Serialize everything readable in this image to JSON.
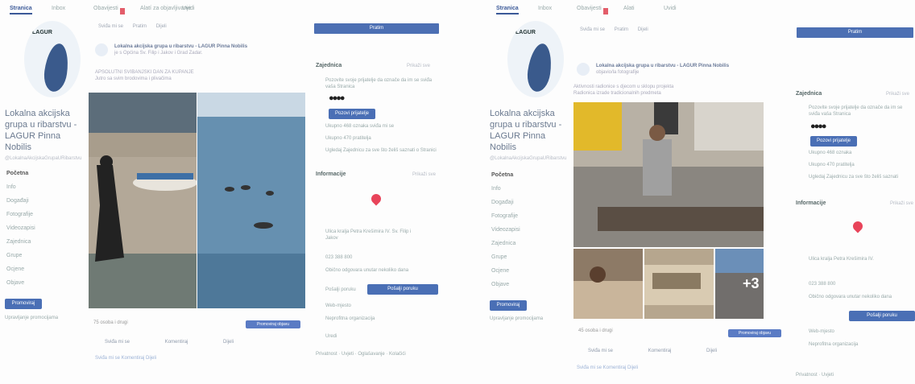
{
  "left": {
    "tabs": [
      "Stranica",
      "Inbox",
      "Obavijesti",
      "Alatí za objavljivanje",
      "Uvidi"
    ],
    "logo_letters": "LAGUR",
    "page_name": "Lokalna akcijska grupa u ribarstvu - LAGUR Pinna Nobilis",
    "handle": "@LokalnaAkcijskaGrupaURibarstvu",
    "nav": [
      "Početna",
      "Info",
      "Događaji",
      "Fotografije",
      "Videozapisi",
      "Zajednica",
      "Grupe",
      "Ocjene",
      "Objave"
    ],
    "promote": "Promoviraj",
    "manage_promotions": "Upravljanje promocijama",
    "action_bar": [
      "Sviđa mi se",
      "Pratim",
      "Dijeli"
    ],
    "post_title": "Lokalna akcijska grupa u ribarstvu - LAGUR Pinna Nobilis",
    "post_sub": "je s Općina Sv. Filip i Jakov i Grad Zadar.",
    "post_text": "APSOLUTNI SVIBANJSKI DAN ZA KUPANJE",
    "post_more": "Jutro sa svim brodovima i plivačima",
    "likes": "75 osoba i drugi",
    "boost": "Promoviraj objavu",
    "reactions": [
      "Sviđa mi se",
      "Komentiraj",
      "Dijeli"
    ],
    "comment": "Sviđa mi se Komentiraj Dijeli",
    "top_button": "Pratim",
    "community_title": "Zajednica",
    "community_link": "Prikaži sve",
    "invite_text": "Pozovite svoje prijatelje da označe da im se sviđa vaša Stranica",
    "invite_btn": "Pozovi prijatelje",
    "c1": "Ukupno 468 oznaka sviđa mi se",
    "c2": "Ukupno 470 pratitelja",
    "c3": "Ugledaj Zajednicu za sve što želiš saznati o Stranici",
    "about_title": "Informacije",
    "about_link": "Prikaži sve",
    "addr": "Ulica kralja Petra Krešimira IV. Sv. Filip i Jakov",
    "phone": "023 388 800",
    "resp": "Obično odgovara unutar nekoliko dana",
    "send_btn": "Pošalji poruku",
    "send_link": "Pošalji poruku",
    "www": "Web-mjesto",
    "category": "Neprofitna organizacija",
    "edit": "Uredi",
    "footer": "Privatnost · Uvjeti · Oglašavanje · Kolačići"
  },
  "right": {
    "tabs": [
      "Stranica",
      "Inbox",
      "Obavijesti",
      "Alati",
      "Uvidi"
    ],
    "logo_letters": "LAGUR",
    "page_name": "Lokalna akcijska grupa u ribarstvu - LAGUR Pinna Nobilis",
    "handle": "@LokalnaAkcijskaGrupaURibarstvu",
    "nav": [
      "Početna",
      "Info",
      "Događaji",
      "Fotografije",
      "Videozapisi",
      "Zajednica",
      "Grupe",
      "Ocjene",
      "Objave"
    ],
    "promote": "Promoviraj",
    "manage_promotions": "Upravljanje promocijama",
    "action_bar": [
      "Sviđa mi se",
      "Pratim",
      "Dijeli"
    ],
    "post_title": "Lokalna akcijska grupa u ribarstvu - LAGUR Pinna Nobilis",
    "post_sub": "objavio/la fotografije",
    "post_text": "Aktivnosti radionice s djecom u sklopu projekta",
    "post_more": "Radionica izrade tradicionalnih predmeta",
    "likes": "45 osoba i drugi",
    "boost": "Promoviraj objavu",
    "plus": "+3",
    "reactions": [
      "Sviđa mi se",
      "Komentiraj",
      "Dijeli"
    ],
    "comment": "Sviđa mi se Komentiraj Dijeli",
    "top_button": "Pratim",
    "community_title": "Zajednica",
    "community_link": "Prikaži sve",
    "invite_text": "Pozovite svoje prijatelje da označe da im se sviđa vaša Stranica",
    "invite_btn": "Pozovi prijatelje",
    "c1": "Ukupno 468 oznaka",
    "c2": "Ukupno 470 pratitelja",
    "c3": "Ugledaj Zajednicu za sve što želiš saznati",
    "about_title": "Informacije",
    "about_link": "Prikaži sve",
    "addr": "Ulica kralja Petra Krešimira IV.",
    "phone": "023 388 800",
    "resp": "Obično odgovara unutar nekoliko dana",
    "send_btn": "Pošalji poruku",
    "www": "Web-mjesto",
    "category": "Neprofitna organizacija",
    "footer": "Privatnost · Uvjeti"
  },
  "colors": {
    "accent": "#3b5998",
    "button": "#4a6fb5",
    "pin": "#e8445a",
    "badge": "#e35d6a"
  }
}
